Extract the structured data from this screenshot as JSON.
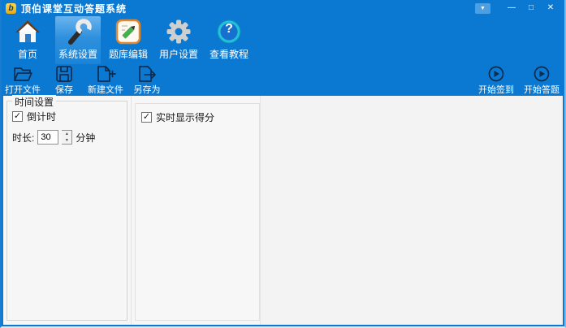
{
  "titlebar": {
    "title": "顶伯课堂互动答题系统",
    "logo_glyph": "b",
    "controls": {
      "dropdown": "▼",
      "minimize": "—",
      "maximize": "□",
      "close": "✕"
    }
  },
  "main_toolbar": {
    "items": [
      {
        "label": "首页",
        "icon": "home-icon",
        "selected": false
      },
      {
        "label": "系统设置",
        "icon": "wrench-icon",
        "selected": true
      },
      {
        "label": "题库编辑",
        "icon": "notepad-pencil-icon",
        "selected": false
      },
      {
        "label": "用户设置",
        "icon": "gear-icon",
        "selected": false
      },
      {
        "label": "查看教程",
        "icon": "help-icon",
        "selected": false
      }
    ],
    "help_glyph": "?"
  },
  "file_toolbar": {
    "left": [
      {
        "label": "打开文件",
        "icon": "open-folder-icon"
      },
      {
        "label": "保存",
        "icon": "floppy-save-icon"
      },
      {
        "label": "新建文件",
        "icon": "new-file-icon"
      },
      {
        "label": "另存为",
        "icon": "save-as-icon"
      }
    ],
    "right": [
      {
        "label": "开始签到",
        "icon": "play-circle-icon"
      },
      {
        "label": "开始答题",
        "icon": "play-circle-icon"
      }
    ]
  },
  "content": {
    "time_settings": {
      "group_label": "时间设置",
      "countdown": {
        "label": "倒计时",
        "checked": true
      },
      "duration": {
        "label": "时长:",
        "value": "30",
        "unit": "分钟"
      }
    },
    "score_settings": {
      "realtime_score": {
        "label": "实时显示得分",
        "checked": true
      }
    }
  },
  "icons": {
    "check": "✓",
    "spinner_up": "▲",
    "spinner_down": "▼"
  },
  "colors": {
    "frame_blue": "#0b79d2",
    "selected_highlight": "#2e90dd",
    "accent_gold": "#e8a912",
    "icon_navy": "#0d2c4e"
  }
}
